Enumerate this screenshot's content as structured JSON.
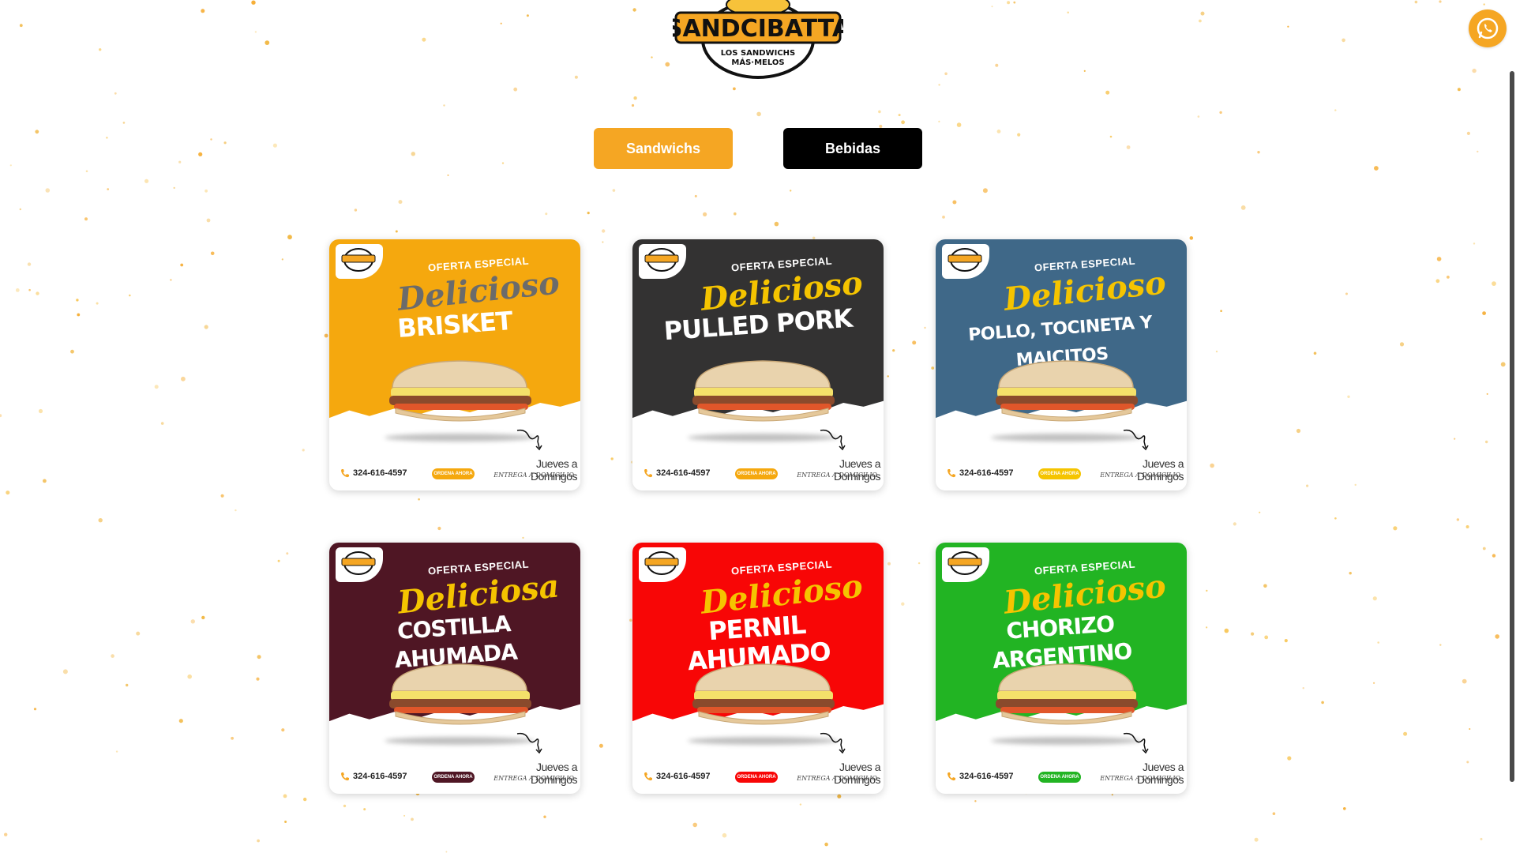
{
  "brand": {
    "name": "SANDCIBATTA",
    "tagline_1": "LOS SANDWICHS",
    "tagline_2": "MÁS·MELOS"
  },
  "tabs": [
    {
      "label": "Sandwichs",
      "active": true,
      "color": "#f5a623"
    },
    {
      "label": "Bebidas",
      "active": false,
      "color": "#000000"
    }
  ],
  "whatsapp": {
    "icon": "whatsapp-icon",
    "color": "#f5a623"
  },
  "menu_cards": [
    {
      "offer": "OFERTA ESPECIAL",
      "adjective": "Delicioso",
      "name": "BRISKET",
      "phone": "324-616-4597",
      "cta": "ORDENA AHORA",
      "days": "Jueves a Domingos",
      "delivery": "ENTREGA A DOMICILIO",
      "bg_color": "#f5a80e",
      "adj_color": "#6b6b6b",
      "cta_color": "#f5a80e"
    },
    {
      "offer": "OFERTA ESPECIAL",
      "adjective": "Delicioso",
      "name": "PULLED PORK",
      "phone": "324-616-4597",
      "cta": "ORDENA AHORA",
      "days": "Jueves a Domingos",
      "delivery": "ENTREGA A DOMICILIO",
      "bg_color": "#333232",
      "adj_color": "#f5c400",
      "cta_color": "#f5a80e"
    },
    {
      "offer": "OFERTA ESPECIAL",
      "adjective": "Delicioso",
      "name": "POLLO, TOCINETA Y MAICITOS",
      "phone": "324-616-4597",
      "cta": "ORDENA AHORA",
      "days": "Jueves a Domingos",
      "delivery": "ENTREGA A DOMICILIO",
      "bg_color": "#3f6888",
      "adj_color": "#f5c400",
      "cta_color": "#f5c400"
    },
    {
      "offer": "OFERTA ESPECIAL",
      "adjective": "Deliciosa",
      "name": "COSTILLA AHUMADA",
      "phone": "324-616-4597",
      "cta": "ORDENA AHORA",
      "days": "Jueves a Domingos",
      "delivery": "ENTREGA A DOMICILIO",
      "bg_color": "#4f1624",
      "adj_color": "#f5c400",
      "cta_color": "#4f1624"
    },
    {
      "offer": "OFERTA ESPECIAL",
      "adjective": "Delicioso",
      "name": "PERNIL AHUMADO",
      "phone": "324-616-4597",
      "cta": "ORDENA AHORA",
      "days": "Jueves a Domingos",
      "delivery": "ENTREGA A DOMICILIO",
      "bg_color": "#f80606",
      "adj_color": "#f5c400",
      "cta_color": "#f80606"
    },
    {
      "offer": "OFERTA ESPECIAL",
      "adjective": "Delicioso",
      "name": "CHORIZO ARGENTINO",
      "phone": "324-616-4597",
      "cta": "ORDENA AHORA",
      "days": "Jueves a Domingos",
      "delivery": "ENTREGA A DOMICILIO",
      "bg_color": "#22b423",
      "adj_color": "#f5c400",
      "cta_color": "#22b423"
    }
  ]
}
